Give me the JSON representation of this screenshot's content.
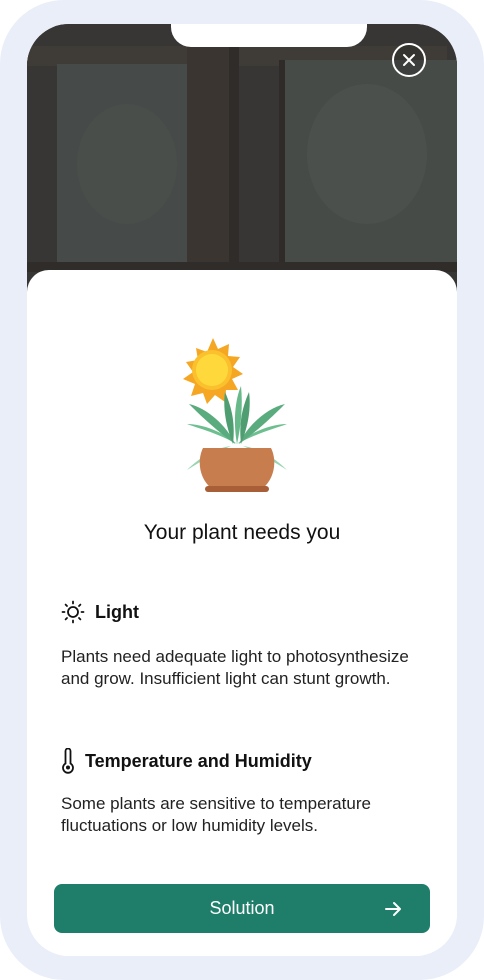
{
  "dialog": {
    "title": "Your plant needs you",
    "close_icon": "close-icon"
  },
  "illustration": {
    "icon": "plant-with-sun-illustration"
  },
  "sections": [
    {
      "icon": "sun-icon",
      "heading": "Light",
      "text": "Plants need adequate light to photosynthesize and grow. Insufficient light can stunt growth."
    },
    {
      "icon": "thermometer-icon",
      "heading": "Temperature and Humidity",
      "text": "Some plants are sensitive to temperature fluctuations or low humidity levels."
    }
  ],
  "cta": {
    "label": "Solution",
    "icon": "arrow-right-icon"
  },
  "colors": {
    "accent": "#1e7e6a",
    "frame": "#eaeef8",
    "photo": "#3c3c3b"
  }
}
